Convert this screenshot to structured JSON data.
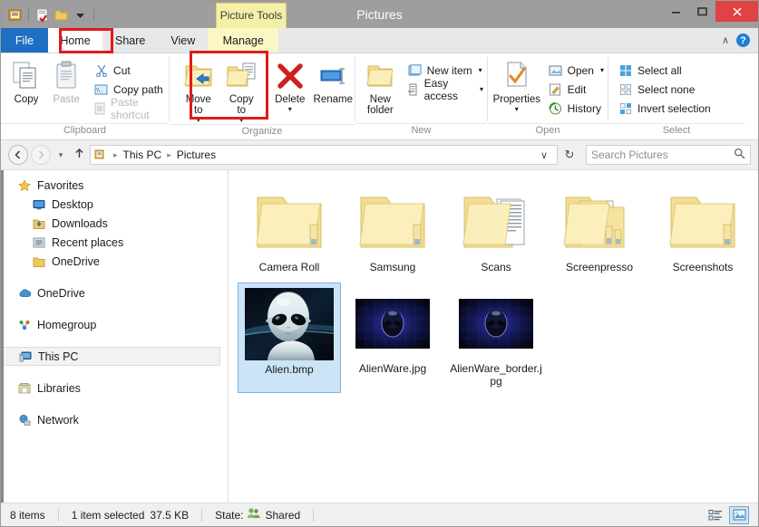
{
  "window": {
    "title": "Pictures",
    "minimize_label": "–",
    "maximize_label": "☐",
    "close_label": "✕",
    "contextual_tab": "Picture Tools"
  },
  "quick_access": {
    "items": [
      {
        "name": "properties-icon",
        "label": ""
      },
      {
        "name": "new-folder-icon",
        "label": ""
      },
      {
        "name": "folder-icon",
        "label": ""
      },
      {
        "name": "customize-qat-icon",
        "label": "▾"
      }
    ]
  },
  "tabs": [
    {
      "id": "file",
      "label": "File"
    },
    {
      "id": "home",
      "label": "Home"
    },
    {
      "id": "share",
      "label": "Share"
    },
    {
      "id": "view",
      "label": "View"
    },
    {
      "id": "manage",
      "label": "Manage"
    }
  ],
  "tab_right": {
    "collapse_label": "∧",
    "help_label": "?"
  },
  "ribbon": {
    "groups": [
      {
        "id": "clipboard",
        "label": "Clipboard",
        "big_buttons": [
          {
            "id": "copy",
            "label": "Copy",
            "icon": "copy-icon",
            "disabled": false
          },
          {
            "id": "paste",
            "label": "Paste",
            "icon": "paste-icon",
            "disabled": true
          }
        ],
        "small_buttons": [
          {
            "id": "cut",
            "label": "Cut",
            "icon": "scissors-icon",
            "disabled": false
          },
          {
            "id": "copy-path",
            "label": "Copy path",
            "icon": "copy-path-icon",
            "disabled": false
          },
          {
            "id": "paste-shortcut",
            "label": "Paste shortcut",
            "icon": "paste-shortcut-icon",
            "disabled": true
          }
        ]
      },
      {
        "id": "organize",
        "label": "Organize",
        "big_buttons": [
          {
            "id": "move-to",
            "label": "Move\nto",
            "icon": "move-to-icon",
            "caret": true
          },
          {
            "id": "copy-to",
            "label": "Copy\nto",
            "icon": "copy-to-icon",
            "caret": true
          },
          {
            "id": "delete",
            "label": "Delete",
            "icon": "delete-icon",
            "caret": true
          },
          {
            "id": "rename",
            "label": "Rename",
            "icon": "rename-icon",
            "caret": false
          }
        ]
      },
      {
        "id": "new",
        "label": "New",
        "big_buttons": [
          {
            "id": "new-folder",
            "label": "New\nfolder",
            "icon": "new-folder-icon",
            "caret": false
          }
        ],
        "small_buttons": [
          {
            "id": "new-item",
            "label": "New item",
            "icon": "new-item-icon",
            "caret": true
          },
          {
            "id": "easy-access",
            "label": "Easy access",
            "icon": "easy-access-icon",
            "caret": true
          }
        ]
      },
      {
        "id": "open",
        "label": "Open",
        "big_buttons": [
          {
            "id": "properties",
            "label": "Properties",
            "icon": "properties-icon",
            "caret": true
          }
        ],
        "small_buttons": [
          {
            "id": "open",
            "label": "Open",
            "icon": "open-icon",
            "caret": true
          },
          {
            "id": "edit",
            "label": "Edit",
            "icon": "edit-icon",
            "caret": false
          },
          {
            "id": "history",
            "label": "History",
            "icon": "history-icon",
            "caret": false
          }
        ]
      },
      {
        "id": "select",
        "label": "Select",
        "small_buttons": [
          {
            "id": "select-all",
            "label": "Select all",
            "icon": "select-all-icon"
          },
          {
            "id": "select-none",
            "label": "Select none",
            "icon": "select-none-icon"
          },
          {
            "id": "invert-selection",
            "label": "Invert selection",
            "icon": "invert-selection-icon"
          }
        ]
      }
    ]
  },
  "annotations": {
    "color": "#e01b1b",
    "boxes": [
      {
        "name": "home-tab-highlight",
        "target": "Home"
      },
      {
        "name": "move-copy-to-highlight",
        "target": "Move to / Copy to"
      }
    ]
  },
  "address_bar": {
    "back_label": "←",
    "forward_label": "→",
    "recent_label": "▾",
    "up_label": "↑",
    "breadcrumb": [
      "This PC",
      "Pictures"
    ],
    "separator": "▸",
    "dropdown_label": "∨",
    "refresh_label": "↻",
    "search_placeholder": "Search Pictures",
    "search_value": "",
    "search_icon": "search-icon"
  },
  "nav_pane": {
    "sections": [
      {
        "id": "favorites",
        "items": [
          {
            "id": "favorites",
            "label": "Favorites",
            "icon": "star-icon",
            "level": 0
          },
          {
            "id": "desktop",
            "label": "Desktop",
            "icon": "desktop-icon",
            "level": 1
          },
          {
            "id": "downloads",
            "label": "Downloads",
            "icon": "downloads-icon",
            "level": 1
          },
          {
            "id": "recent-places",
            "label": "Recent places",
            "icon": "recent-places-icon",
            "level": 1
          },
          {
            "id": "onedrive-fav",
            "label": "OneDrive",
            "icon": "folder-icon",
            "level": 1
          }
        ]
      },
      {
        "id": "onedrive",
        "items": [
          {
            "id": "onedrive",
            "label": "OneDrive",
            "icon": "cloud-icon",
            "level": 0
          }
        ]
      },
      {
        "id": "homegroup",
        "items": [
          {
            "id": "homegroup",
            "label": "Homegroup",
            "icon": "homegroup-icon",
            "level": 0
          }
        ]
      },
      {
        "id": "thispc",
        "items": [
          {
            "id": "this-pc",
            "label": "This PC",
            "icon": "computer-icon",
            "level": 0,
            "selected": true
          }
        ]
      },
      {
        "id": "libraries",
        "items": [
          {
            "id": "libraries",
            "label": "Libraries",
            "icon": "libraries-icon",
            "level": 0
          }
        ]
      },
      {
        "id": "network",
        "items": [
          {
            "id": "network",
            "label": "Network",
            "icon": "network-icon",
            "level": 0
          }
        ]
      }
    ]
  },
  "files": [
    {
      "id": "camera-roll",
      "name": "Camera Roll",
      "type": "folder",
      "selected": false
    },
    {
      "id": "samsung",
      "name": "Samsung",
      "type": "folder",
      "selected": false
    },
    {
      "id": "scans",
      "name": "Scans",
      "type": "folder-documents",
      "selected": false
    },
    {
      "id": "screenpresso",
      "name": "Screenpresso",
      "type": "folder-stack",
      "selected": false
    },
    {
      "id": "screenshots",
      "name": "Screenshots",
      "type": "folder",
      "selected": false
    },
    {
      "id": "alien-bmp",
      "name": "Alien.bmp",
      "type": "image-alien",
      "selected": true
    },
    {
      "id": "alienware-jpg",
      "name": "AlienWare.jpg",
      "type": "image-alienware",
      "selected": false
    },
    {
      "id": "alienware-border-jpg",
      "name": "AlienWare_border.jpg",
      "type": "image-alienware",
      "selected": false
    }
  ],
  "status_bar": {
    "item_count": "8 items",
    "selection": "1 item selected",
    "size": "37.5 KB",
    "state_label": "State:",
    "state_value": "Shared",
    "state_icon": "shared-users-icon",
    "view_details_icon": "details-view-icon",
    "view_thumbnails_icon": "large-icons-view-icon",
    "active_view": "large-icons-view-icon"
  }
}
